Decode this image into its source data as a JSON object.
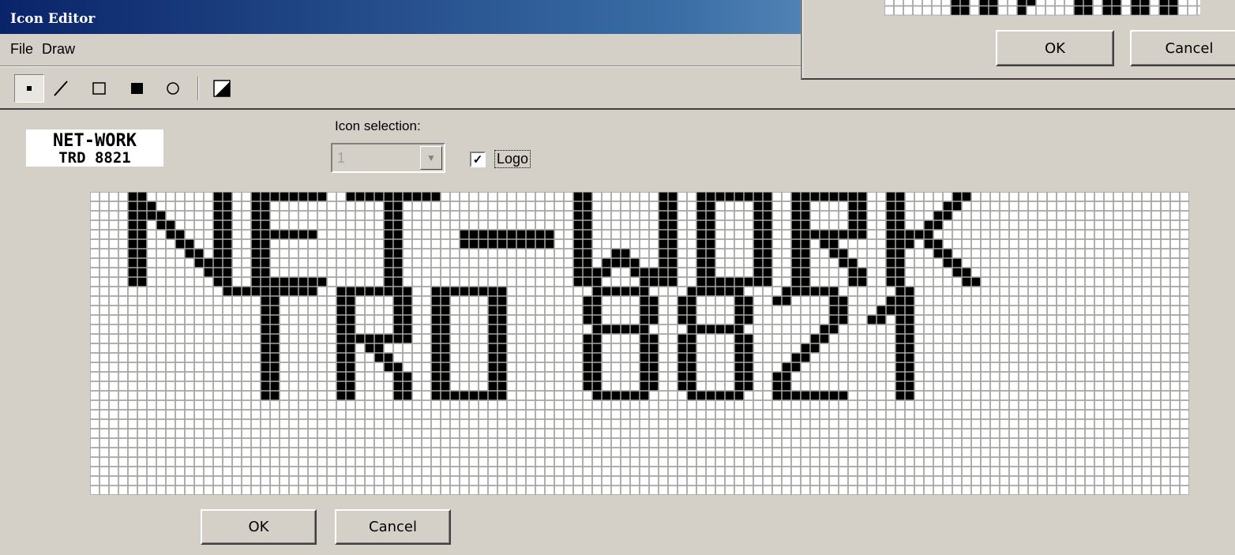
{
  "window": {
    "title": "Icon Editor"
  },
  "menu": {
    "items": [
      "File",
      "Draw"
    ]
  },
  "toolbar": {
    "tools": [
      {
        "name": "pixel-tool",
        "icon": "dot",
        "active": true
      },
      {
        "name": "line-tool",
        "icon": "line",
        "active": false
      },
      {
        "name": "rectangle-outline-tool",
        "icon": "rect-outline",
        "active": false
      },
      {
        "name": "rectangle-filled-tool",
        "icon": "rect-filled",
        "active": false
      },
      {
        "name": "ellipse-tool",
        "icon": "ellipse",
        "active": false
      },
      {
        "name": "invert-tool",
        "icon": "invert",
        "active": false
      }
    ]
  },
  "preview": {
    "line1": "NET-WORK",
    "line2": "TRD 8821"
  },
  "icon_selection": {
    "label": "Icon selection:",
    "value": "1"
  },
  "logo_checkbox": {
    "label": "Logo",
    "checked": true
  },
  "buttons": {
    "ok": "OK",
    "cancel": "Cancel"
  },
  "overlay_dialog": {
    "ok": "OK",
    "cancel": "Cancel"
  },
  "colors": {
    "title_start": "#0a246a",
    "title_end": "#a6caf0",
    "face": "#d4d0c8",
    "pixel_on": "#000000",
    "pixel_off": "#ffffff"
  }
}
